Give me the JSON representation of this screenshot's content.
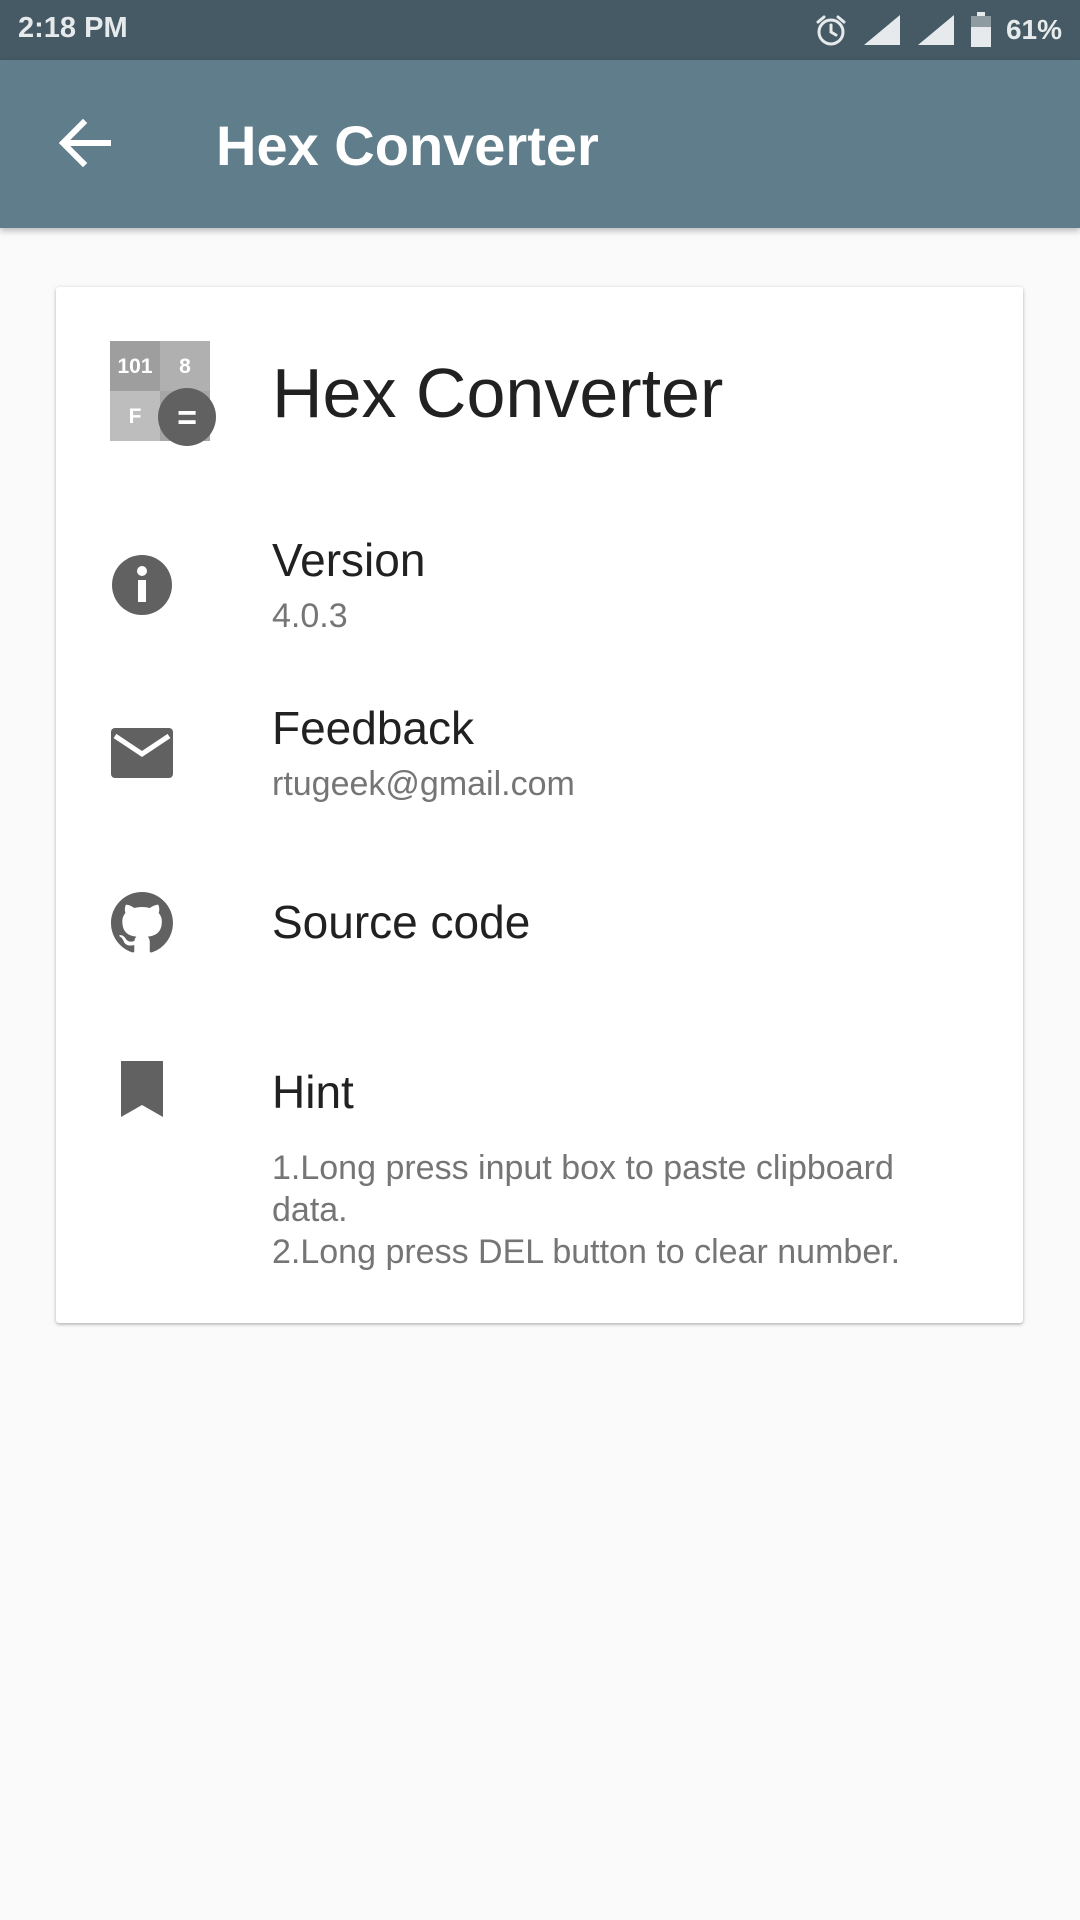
{
  "status_bar": {
    "time": "2:18 PM",
    "battery": "61%",
    "icons": [
      "alarm-icon",
      "signal-icon",
      "signal-icon",
      "battery-icon"
    ]
  },
  "app_bar": {
    "title": "Hex Converter",
    "back_icon": "arrow-back-icon",
    "background": "#607d8b"
  },
  "about": {
    "logo": {
      "cells": [
        "101",
        "8",
        "F"
      ],
      "badge": "="
    },
    "app_name": "Hex Converter",
    "version": {
      "icon": "info-icon",
      "title": "Version",
      "value": "4.0.3"
    },
    "feedback": {
      "icon": "mail-icon",
      "title": "Feedback",
      "value": "rtugeek@gmail.com"
    },
    "source": {
      "icon": "github-icon",
      "title": "Source code"
    },
    "hint": {
      "icon": "bookmark-icon",
      "title": "Hint",
      "lines": [
        "1.Long press input box to paste clipboard data.",
        "2.Long press DEL button to clear number."
      ]
    }
  },
  "colors": {
    "status_bar": "#455a64",
    "app_bar": "#607d8b",
    "icon_gray": "#616161",
    "background": "#fafafa"
  }
}
